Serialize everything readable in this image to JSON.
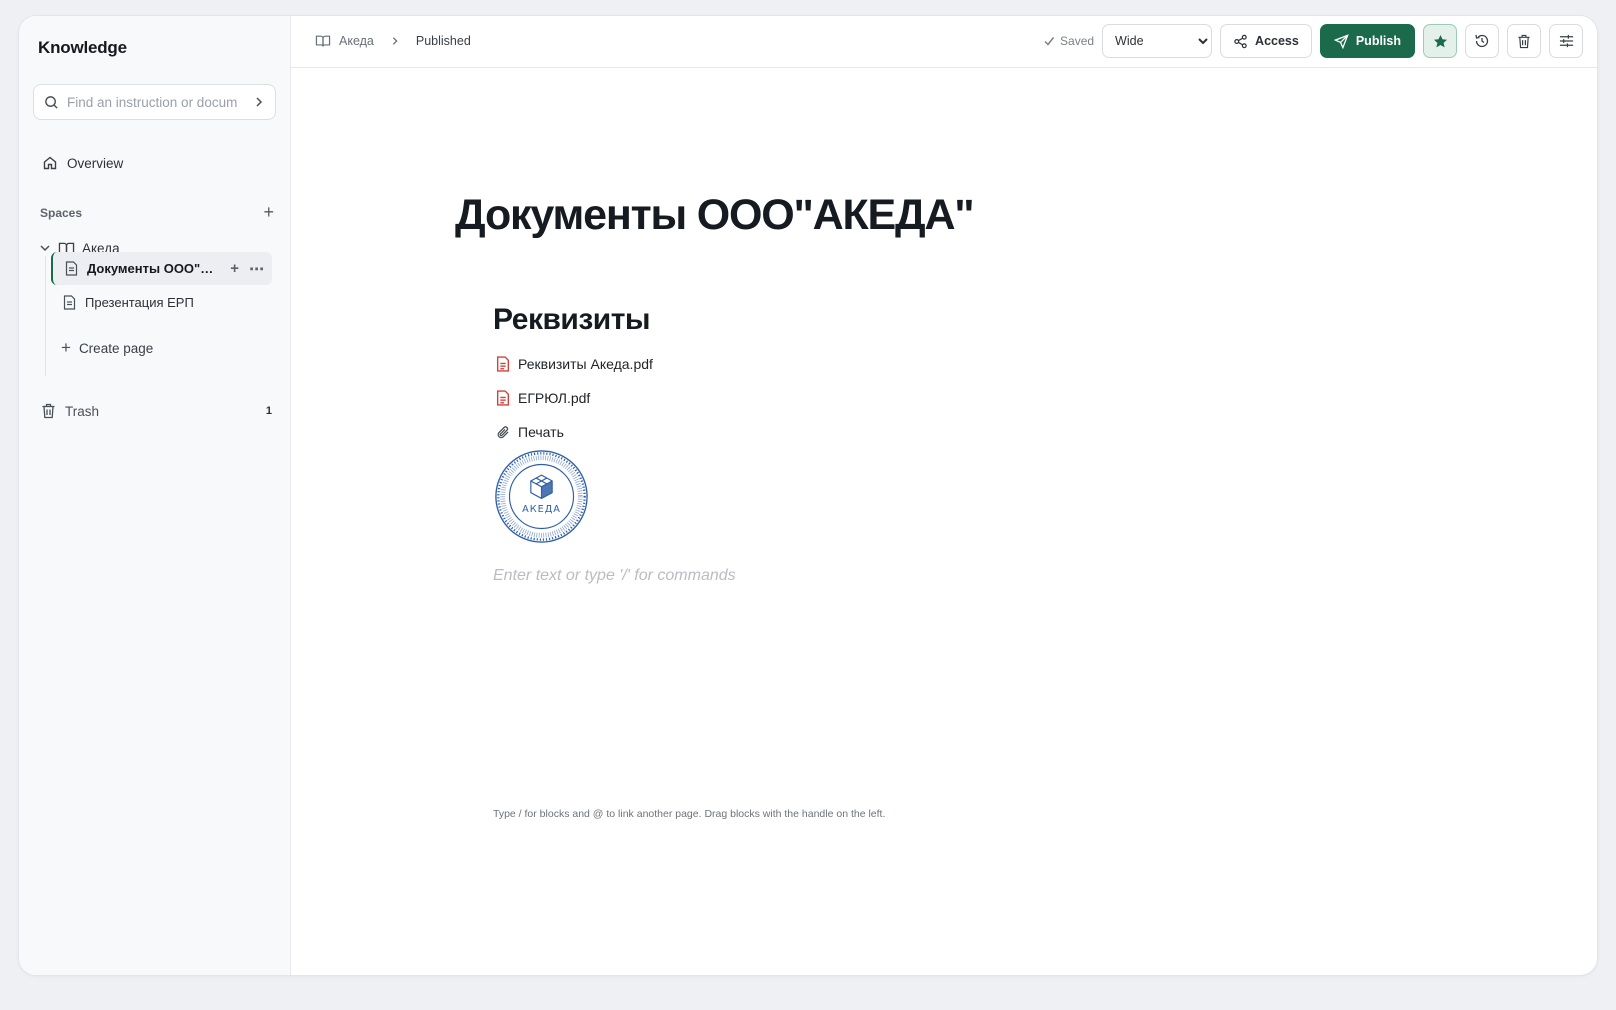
{
  "sidebar": {
    "brand": "Knowledge",
    "search_placeholder": "Find an instruction or document",
    "overview_label": "Overview",
    "spaces_label": "Spaces",
    "space": {
      "name": "Акеда"
    },
    "pages": [
      {
        "label": "Документы ООО\"АК...",
        "active": true
      },
      {
        "label": "Презентация ЕРП",
        "active": false
      }
    ],
    "create_page_label": "Create page",
    "trash_label": "Trash",
    "trash_count": "1"
  },
  "topbar": {
    "breadcrumb_space": "Акеда",
    "breadcrumb_status": "Published",
    "saved_label": "Saved",
    "width_options": [
      "Wide"
    ],
    "width_selected": "Wide",
    "access_label": "Access",
    "publish_label": "Publish"
  },
  "document": {
    "title": "Документы ООО\"АКЕДА\"",
    "heading": "Реквизиты",
    "files": [
      {
        "name": "Реквизиты Акеда.pdf",
        "icon": "pdf-icon"
      },
      {
        "name": "ЕГРЮЛ.pdf",
        "icon": "pdf-icon"
      },
      {
        "name": "Печать",
        "icon": "paperclip-icon"
      }
    ],
    "seal_text": "АКЕДА",
    "placeholder": "Enter text or type '/' for commands",
    "hint": "Type / for blocks and @ to link another page. Drag blocks with the handle on the left."
  },
  "colors": {
    "accent": "#1b6a4c",
    "pdf_icon": "#d2403a",
    "seal": "#2f5ea8"
  }
}
